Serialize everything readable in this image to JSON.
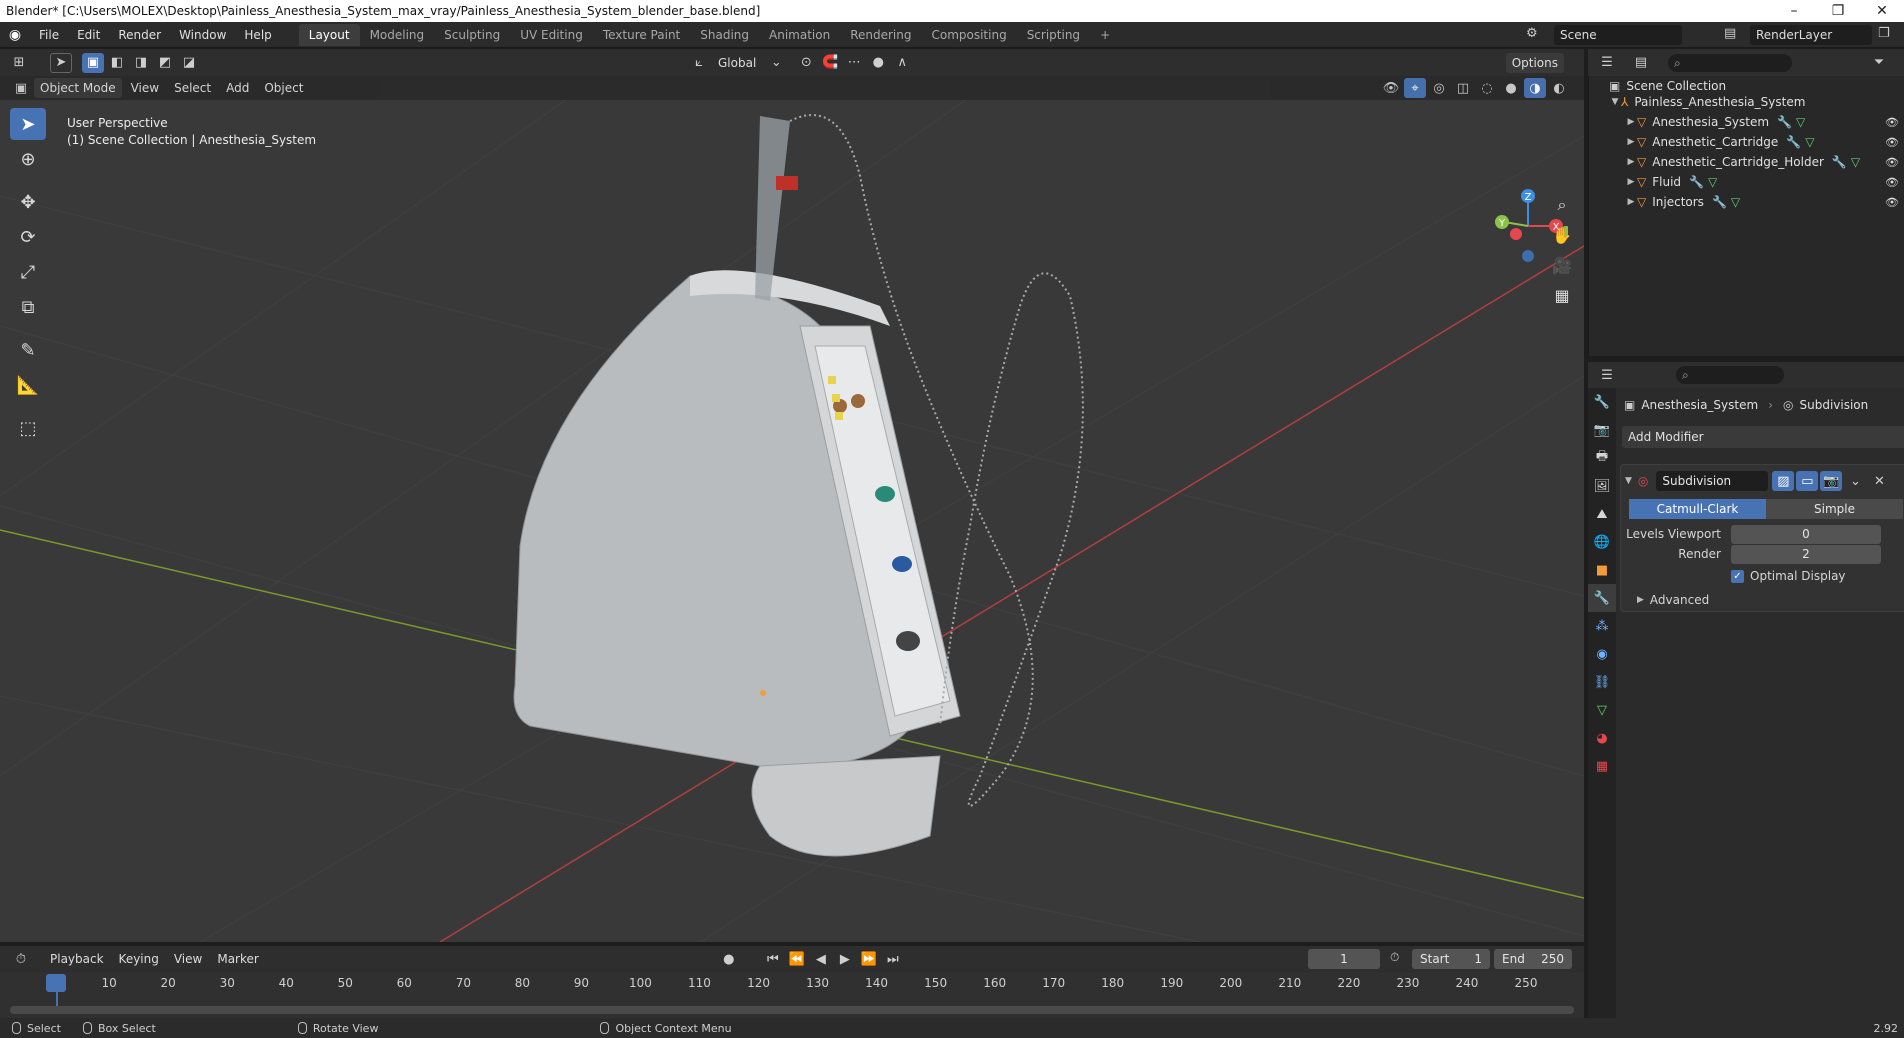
{
  "window": {
    "title": "Blender* [C:\\Users\\MOLEX\\Desktop\\Painless_Anesthesia_System_max_vray/Painless_Anesthesia_System_blender_base.blend]",
    "minimize": "–",
    "restore": "❐",
    "close": "✕"
  },
  "menu": [
    "File",
    "Edit",
    "Render",
    "Window",
    "Help"
  ],
  "workspaces": [
    "Layout",
    "Modeling",
    "Sculpting",
    "UV Editing",
    "Texture Paint",
    "Shading",
    "Animation",
    "Rendering",
    "Compositing",
    "Scripting"
  ],
  "workspace_add": "+",
  "scene": {
    "name": "Scene",
    "render_layer": "RenderLayer"
  },
  "tool_header": {
    "orientation": "Global",
    "options": "Options"
  },
  "viewport_header": {
    "mode": "Object Mode",
    "menus": [
      "View",
      "Select",
      "Add",
      "Object"
    ]
  },
  "viewport": {
    "perspective": "User Perspective",
    "collection": "(1) Scene Collection | Anesthesia_System",
    "gizmo": {
      "x": "X",
      "y": "Y",
      "z": "Z"
    }
  },
  "outliner": {
    "root": "Scene Collection",
    "collection": "Painless_Anesthesia_System",
    "objects": [
      {
        "name": "Anesthesia_System"
      },
      {
        "name": "Anesthetic_Cartridge"
      },
      {
        "name": "Anesthetic_Cartridge_Holder"
      },
      {
        "name": "Fluid"
      },
      {
        "name": "Injectors"
      }
    ]
  },
  "properties": {
    "object": "Anesthesia_System",
    "modifier_context": "Subdivision",
    "add_modifier": "Add Modifier",
    "modifier_name": "Subdivision",
    "method_options": [
      "Catmull-Clark",
      "Simple"
    ],
    "method_selected": "Catmull-Clark",
    "levels_viewport_label": "Levels Viewport",
    "levels_viewport": "0",
    "render_label": "Render",
    "render_levels": "2",
    "optimal_display": "Optimal Display",
    "advanced": "Advanced"
  },
  "timeline": {
    "menus": [
      "Playback",
      "Keying",
      "View",
      "Marker"
    ],
    "current_frame": "1",
    "start_label": "Start",
    "start": "1",
    "end_label": "End",
    "end": "250",
    "ticks": [
      "1",
      "10",
      "20",
      "30",
      "40",
      "50",
      "60",
      "70",
      "80",
      "90",
      "100",
      "110",
      "120",
      "130",
      "140",
      "150",
      "160",
      "170",
      "180",
      "190",
      "200",
      "210",
      "220",
      "230",
      "240",
      "250"
    ]
  },
  "status": {
    "select": "Select",
    "box_select": "Box Select",
    "rotate_view": "Rotate View",
    "context_menu": "Object Context Menu",
    "version": "2.92"
  },
  "colors": {
    "accent": "#4772b3",
    "mesh": "#f29c3b",
    "x_axis": "#e5474f",
    "y_axis": "#8bc34a",
    "z_axis": "#3d8fe3"
  }
}
